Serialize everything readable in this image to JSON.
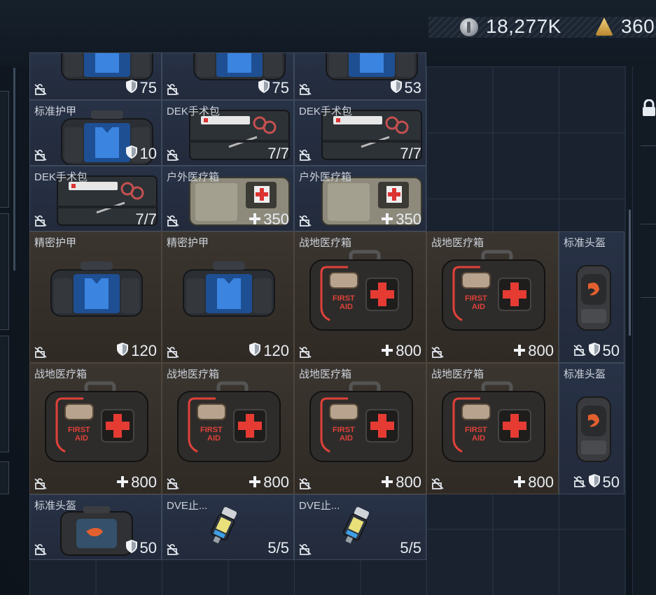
{
  "currency": [
    {
      "icon": "silver-coin-icon",
      "value": "18,277K"
    },
    {
      "icon": "gold-triangle-icon",
      "value": "360"
    }
  ],
  "items": [
    {
      "name": "",
      "value": "75",
      "stat": "shield",
      "bg": "blue",
      "art": "armor",
      "x": 0,
      "y": 0,
      "w": 1,
      "h": 1
    },
    {
      "name": "",
      "value": "75",
      "stat": "shield",
      "bg": "blue",
      "art": "armor",
      "x": 1,
      "y": 0,
      "w": 1,
      "h": 1
    },
    {
      "name": "",
      "value": "53",
      "stat": "shield",
      "bg": "blue",
      "art": "armor",
      "x": 2,
      "y": 0,
      "w": 1,
      "h": 1
    },
    {
      "name": "标准护甲",
      "value": "10",
      "stat": "shield",
      "bg": "blue",
      "art": "armor",
      "x": 0,
      "y": 1,
      "w": 1,
      "h": 1
    },
    {
      "name": "DEK手术包",
      "value": "7/7",
      "stat": "none",
      "bg": "blue",
      "art": "surgery",
      "x": 1,
      "y": 1,
      "w": 1,
      "h": 1
    },
    {
      "name": "DEK手术包",
      "value": "7/7",
      "stat": "none",
      "bg": "blue",
      "art": "surgery",
      "x": 2,
      "y": 1,
      "w": 1,
      "h": 1
    },
    {
      "name": "DEK手术包",
      "value": "7/7",
      "stat": "none",
      "bg": "blue",
      "art": "surgery",
      "x": 0,
      "y": 2,
      "w": 1,
      "h": 1
    },
    {
      "name": "户外医疗箱",
      "value": "350",
      "stat": "plus",
      "bg": "blue",
      "art": "outdoor",
      "x": 1,
      "y": 2,
      "w": 1,
      "h": 1
    },
    {
      "name": "户外医疗箱",
      "value": "350",
      "stat": "plus",
      "bg": "blue",
      "art": "outdoor",
      "x": 2,
      "y": 2,
      "w": 1,
      "h": 1
    },
    {
      "name": "精密护甲",
      "value": "120",
      "stat": "shield",
      "bg": "brown",
      "art": "armor",
      "x": 0,
      "y": 3,
      "w": 1,
      "h": 1
    },
    {
      "name": "精密护甲",
      "value": "120",
      "stat": "shield",
      "bg": "brown",
      "art": "armor",
      "x": 1,
      "y": 3,
      "w": 1,
      "h": 1
    },
    {
      "name": "战地医疗箱",
      "value": "800",
      "stat": "plus",
      "bg": "brown",
      "art": "firstaid",
      "x": 2,
      "y": 3,
      "w": 1,
      "h": 1
    },
    {
      "name": "战地医疗箱",
      "value": "800",
      "stat": "plus",
      "bg": "brown",
      "art": "firstaid",
      "x": 3,
      "y": 3,
      "w": 1,
      "h": 1
    },
    {
      "name": "标准头盔",
      "value": "50",
      "stat": "shield",
      "bg": "blue",
      "art": "helmet",
      "x": 4,
      "y": 3,
      "w": 1,
      "h": 1
    },
    {
      "name": "战地医疗箱",
      "value": "800",
      "stat": "plus",
      "bg": "brown",
      "art": "firstaid",
      "x": 0,
      "y": 4,
      "w": 1,
      "h": 1
    },
    {
      "name": "战地医疗箱",
      "value": "800",
      "stat": "plus",
      "bg": "brown",
      "art": "firstaid",
      "x": 1,
      "y": 4,
      "w": 1,
      "h": 1
    },
    {
      "name": "战地医疗箱",
      "value": "800",
      "stat": "plus",
      "bg": "brown",
      "art": "firstaid",
      "x": 2,
      "y": 4,
      "w": 1,
      "h": 1
    },
    {
      "name": "战地医疗箱",
      "value": "800",
      "stat": "plus",
      "bg": "brown",
      "art": "firstaid",
      "x": 3,
      "y": 4,
      "w": 1,
      "h": 1
    },
    {
      "name": "标准头盔",
      "value": "50",
      "stat": "shield",
      "bg": "blue",
      "art": "helmet",
      "x": 4,
      "y": 4,
      "w": 1,
      "h": 1
    },
    {
      "name": "标准头盔",
      "value": "50",
      "stat": "shield",
      "bg": "blue",
      "art": "helmetbag",
      "x": 0,
      "y": 5,
      "w": 1,
      "h": 1
    },
    {
      "name": "DVE止...",
      "value": "5/5",
      "stat": "none",
      "bg": "blue",
      "art": "injector",
      "x": 1,
      "y": 5,
      "w": 1,
      "h": 1
    },
    {
      "name": "DVE止...",
      "value": "5/5",
      "stat": "none",
      "bg": "blue",
      "art": "injector",
      "x": 2,
      "y": 5,
      "w": 1,
      "h": 1
    }
  ],
  "colors": {
    "accent_red": "#e0413a",
    "armor_blue": "#2f74d0"
  }
}
